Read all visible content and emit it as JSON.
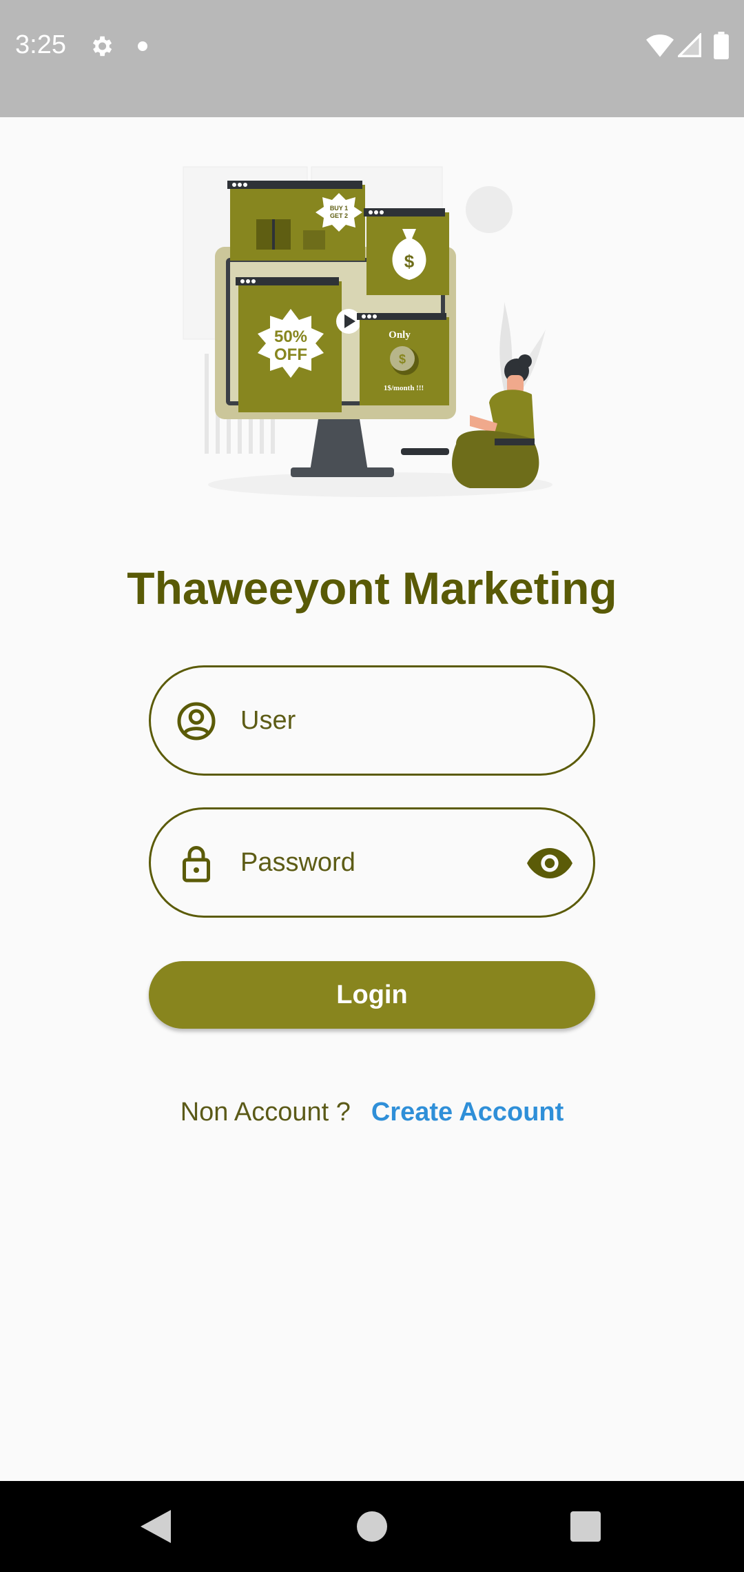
{
  "status_bar": {
    "time": "3:25",
    "icons": [
      "gear-icon",
      "notification-dot",
      "wifi-icon",
      "signal-icon",
      "battery-icon"
    ]
  },
  "illustration": {
    "sale_badge": "50% OFF",
    "promo_badge": "BUY 1 GET 2",
    "price_card": "Only",
    "price_text": "1$/month !!!",
    "money_symbol": "$"
  },
  "app_title": "Thaweeyont Marketing",
  "form": {
    "user_placeholder": "User",
    "password_placeholder": "Password",
    "login_label": "Login"
  },
  "signup": {
    "prompt": "Non Account ?",
    "link": "Create Account"
  },
  "colors": {
    "accent": "#88851e",
    "title": "#595a06",
    "link": "#2f8fd8"
  }
}
